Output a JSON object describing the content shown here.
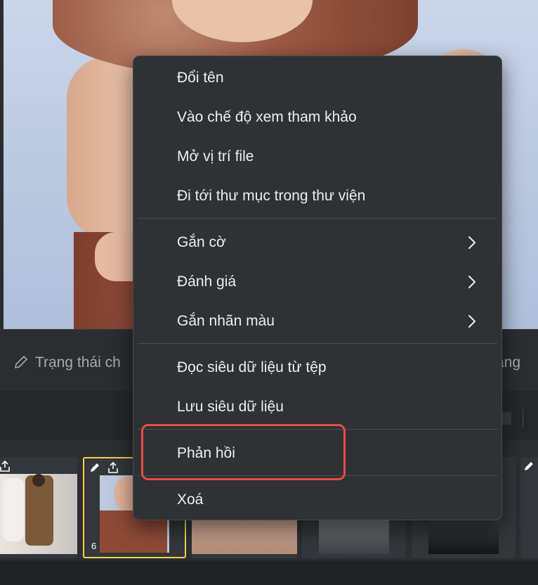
{
  "status_bar": {
    "status_text": "Trạng thái ch",
    "status_right": "ạng"
  },
  "filmstrip": {
    "selected_badge": "6"
  },
  "context_menu": {
    "items": [
      {
        "label": "Đổi tên"
      },
      {
        "label": "Vào chế độ xem tham khảo"
      },
      {
        "label": "Mở vị trí file"
      },
      {
        "label": "Đi tới thư mục trong thư viện"
      },
      {
        "label": "Gắn cờ",
        "submenu": true
      },
      {
        "label": "Đánh giá",
        "submenu": true
      },
      {
        "label": "Gắn nhãn màu",
        "submenu": true
      },
      {
        "label": "Đọc siêu dữ liệu từ tệp"
      },
      {
        "label": "Lưu siêu dữ liệu"
      },
      {
        "label": "Phản hồi"
      },
      {
        "label": "Xoá"
      }
    ]
  },
  "colors": {
    "menu_bg": "#2f3135",
    "highlight": "#e84c46",
    "selected_thumb_border": "#f2d24a"
  },
  "icons": [
    "pencil-icon",
    "chevron-right-icon",
    "share-icon",
    "edit-icon"
  ]
}
